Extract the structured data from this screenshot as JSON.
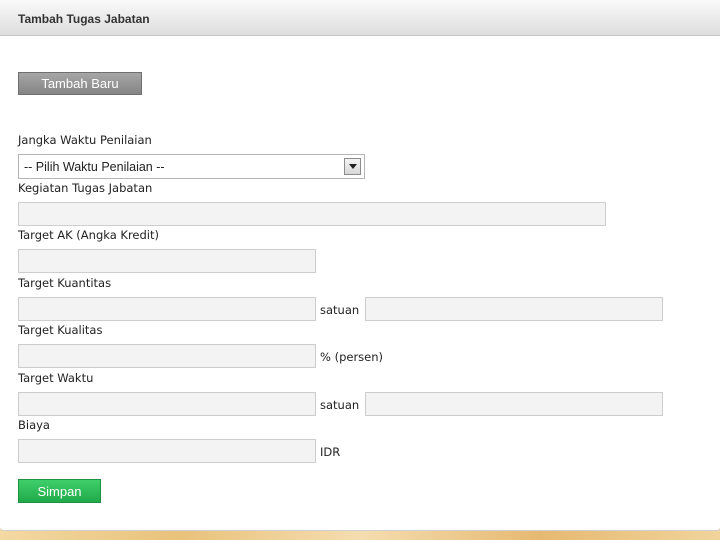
{
  "window": {
    "title": "Tambah Tugas Jabatan"
  },
  "actions": {
    "new_label": "Tambah Baru",
    "save_label": "Simpan"
  },
  "form": {
    "period": {
      "label": "Jangka Waktu Penilaian",
      "selected": "-- Pilih Waktu Penilaian --"
    },
    "activity": {
      "label": "Kegiatan Tugas Jabatan",
      "value": ""
    },
    "target_ak": {
      "label": "Target AK (Angka Kredit)",
      "value": ""
    },
    "target_quantity": {
      "label": "Target Kuantitas",
      "value": "",
      "unit_label": "satuan",
      "unit_value": ""
    },
    "target_quality": {
      "label": "Target Kualitas",
      "value": "",
      "suffix": "% (persen)"
    },
    "target_time": {
      "label": "Target Waktu",
      "value": "",
      "unit_label": "satuan",
      "unit_value": ""
    },
    "cost": {
      "label": "Biaya",
      "value": "",
      "currency": "IDR"
    }
  },
  "colors": {
    "save_button": "#2bbd57",
    "new_button": "#969696"
  }
}
